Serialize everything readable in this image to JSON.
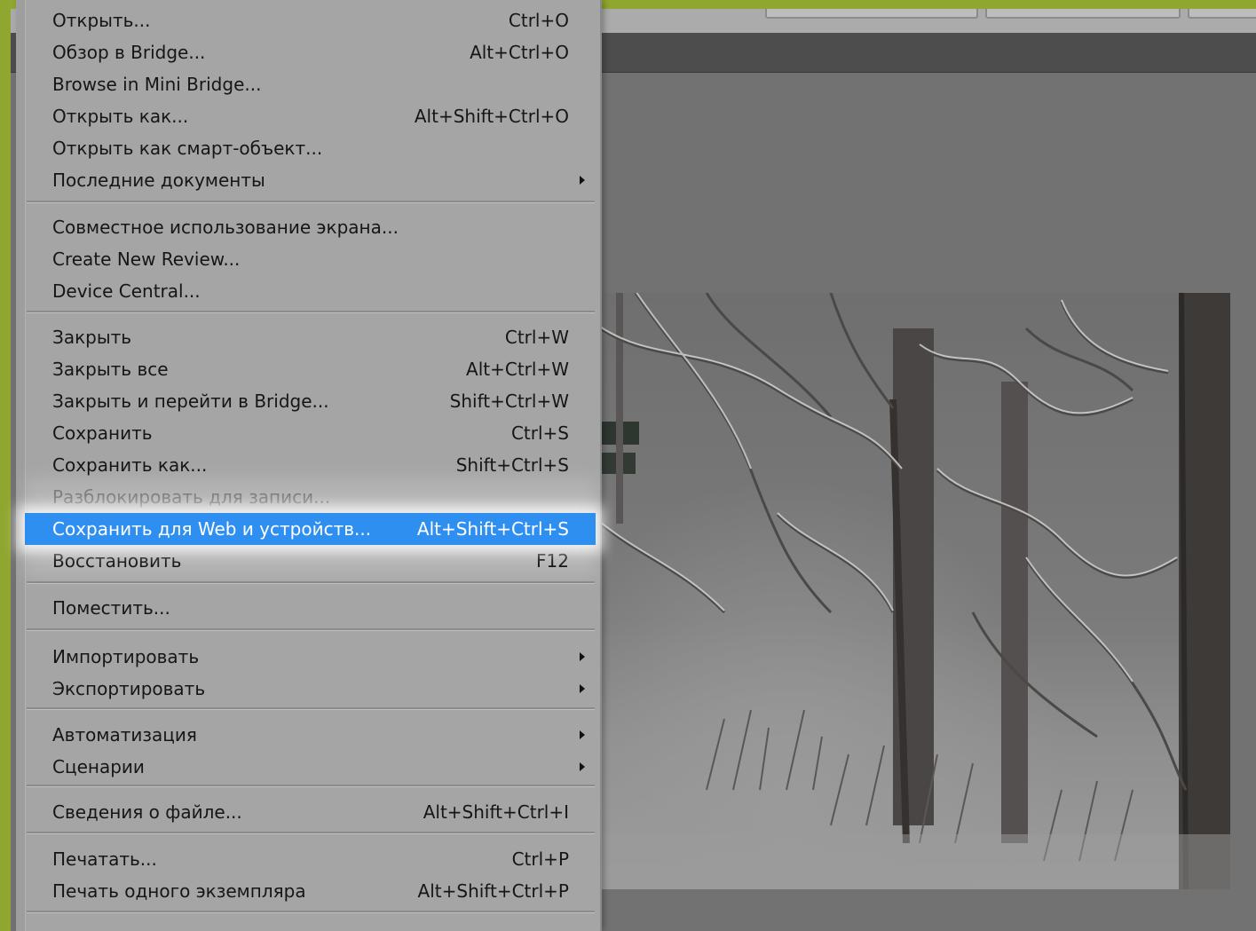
{
  "menu": {
    "items": [
      {
        "label": "Открыть...",
        "shortcut": "Ctrl+O"
      },
      {
        "label": "Обзор в Bridge...",
        "shortcut": "Alt+Ctrl+O"
      },
      {
        "label": "Browse in Mini Bridge...",
        "shortcut": ""
      },
      {
        "label": "Открыть как...",
        "shortcut": "Alt+Shift+Ctrl+O"
      },
      {
        "label": "Открыть как смарт-объект...",
        "shortcut": ""
      },
      {
        "label": "Последние документы",
        "shortcut": ""
      },
      {
        "label": "Совместное использование экрана...",
        "shortcut": ""
      },
      {
        "label": "Create New Review...",
        "shortcut": ""
      },
      {
        "label": "Device Central...",
        "shortcut": ""
      },
      {
        "label": "Закрыть",
        "shortcut": "Ctrl+W"
      },
      {
        "label": "Закрыть все",
        "shortcut": "Alt+Ctrl+W"
      },
      {
        "label": "Закрыть и перейти в Bridge...",
        "shortcut": "Shift+Ctrl+W"
      },
      {
        "label": "Сохранить",
        "shortcut": "Ctrl+S"
      },
      {
        "label": "Сохранить как...",
        "shortcut": "Shift+Ctrl+S"
      },
      {
        "label": "Разблокировать для записи...",
        "shortcut": ""
      },
      {
        "label": "Сохранить для Web и устройств...",
        "shortcut": "Alt+Shift+Ctrl+S"
      },
      {
        "label": "Восстановить",
        "shortcut": "F12"
      },
      {
        "label": "Поместить...",
        "shortcut": ""
      },
      {
        "label": "Импортировать",
        "shortcut": ""
      },
      {
        "label": "Экспортировать",
        "shortcut": ""
      },
      {
        "label": "Автоматизация",
        "shortcut": ""
      },
      {
        "label": "Сценарии",
        "shortcut": ""
      },
      {
        "label": "Сведения о файле...",
        "shortcut": "Alt+Shift+Ctrl+I"
      },
      {
        "label": "Печатать...",
        "shortcut": "Ctrl+P"
      },
      {
        "label": "Печать одного экземпляра",
        "shortcut": "Alt+Shift+Ctrl+P"
      }
    ]
  },
  "colors": {
    "highlight": "#2f8ff0",
    "menu_bg": "#a5a5a5",
    "frame_green": "#8fa62f"
  }
}
